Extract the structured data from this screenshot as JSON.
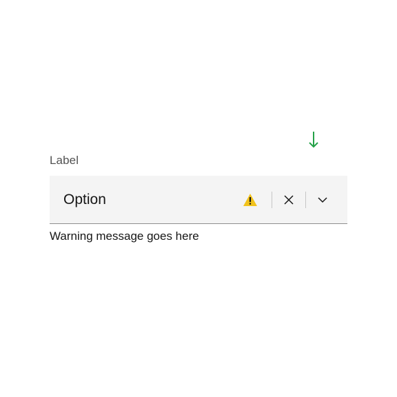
{
  "field": {
    "label": "Label",
    "value": "Option",
    "helper": "Warning message goes here"
  }
}
